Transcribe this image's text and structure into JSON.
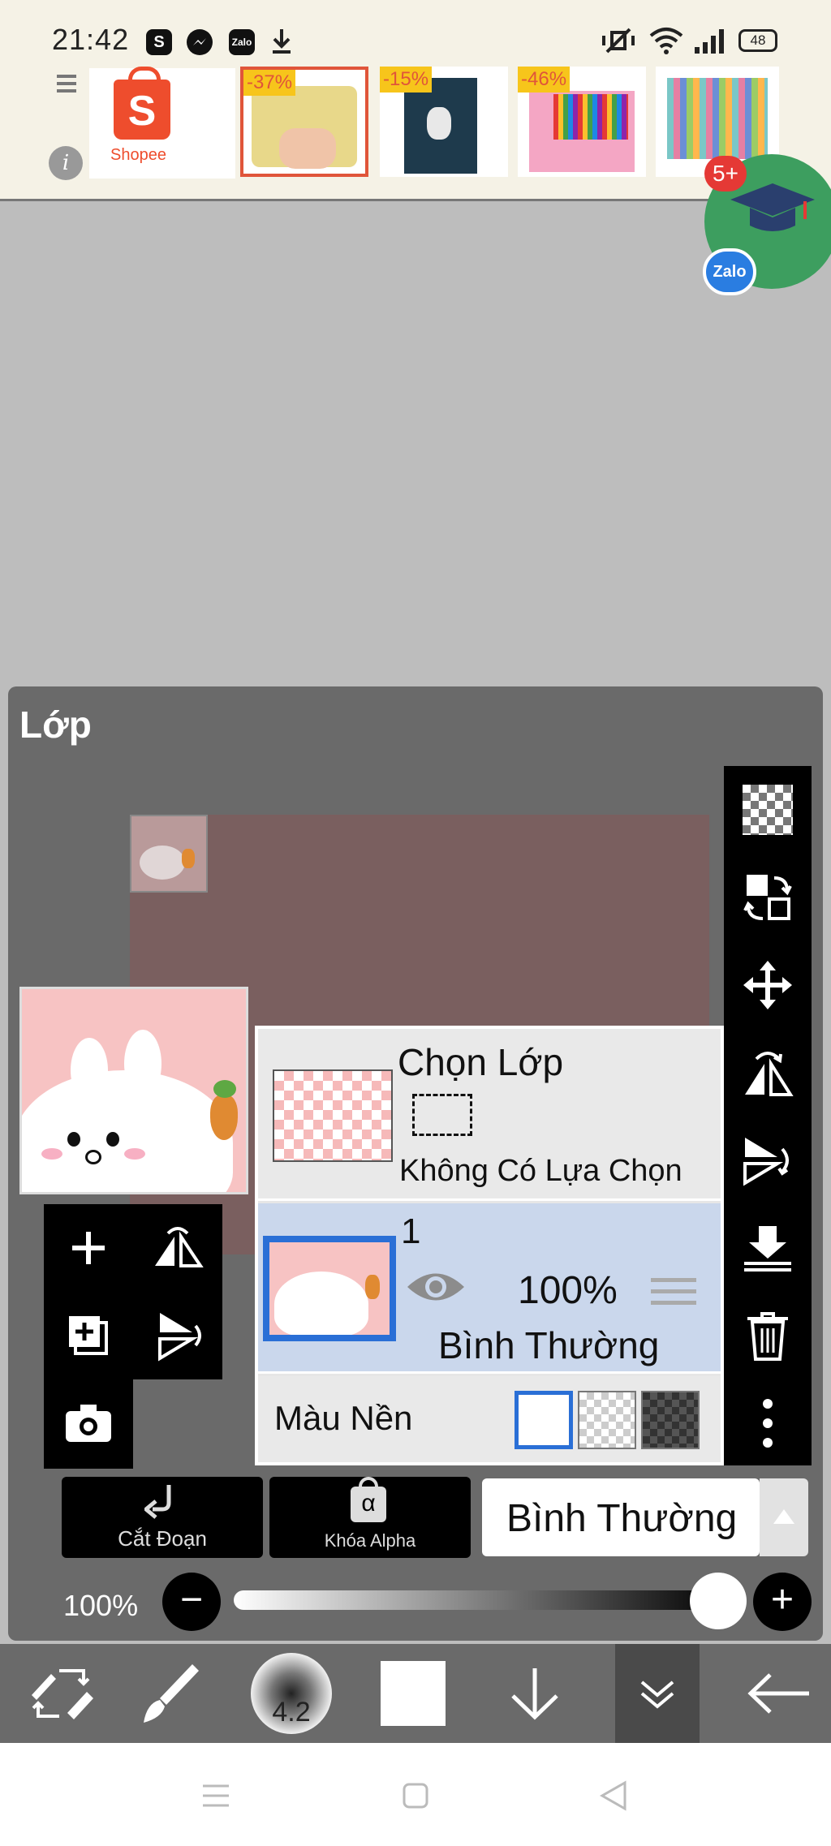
{
  "status_bar": {
    "time": "21:42",
    "app_icons": [
      "skype-icon",
      "messenger-icon",
      "zalo-icon",
      "download-icon"
    ],
    "battery": "48"
  },
  "ad": {
    "brand": "Shopee",
    "products": [
      {
        "discount": "-37%",
        "selected": true
      },
      {
        "discount": "-15%",
        "selected": false
      },
      {
        "discount": "-46%",
        "selected": false
      },
      {
        "discount": "",
        "selected": false
      }
    ]
  },
  "floating": {
    "badge": "5+",
    "chip": "Zalo"
  },
  "layer_panel": {
    "title": "Lớp",
    "selection_layer": {
      "title": "Chọn Lớp",
      "status": "Không Có Lựa Chọn"
    },
    "layer1": {
      "number": "1",
      "opacity": "100%",
      "blend": "Bình Thường"
    },
    "background": {
      "label": "Màu Nền",
      "selected": "white"
    },
    "actions": {
      "clip_label": "Cắt Đoạn",
      "alpha_lock_label": "Khóa Alpha",
      "alpha_symbol": "α"
    },
    "blend_select": "Bình Thường",
    "opacity": {
      "label": "100%",
      "value": 1.0,
      "minus": "−",
      "plus": "+"
    }
  },
  "bottom_toolbar": {
    "brush_size": "4.2"
  },
  "colors": {
    "panel_bg": "#6a6a6a",
    "selected_layer_bg": "#cad7ec",
    "accent_blue": "#2a6fd6",
    "shopee_orange": "#ee4d2d"
  }
}
